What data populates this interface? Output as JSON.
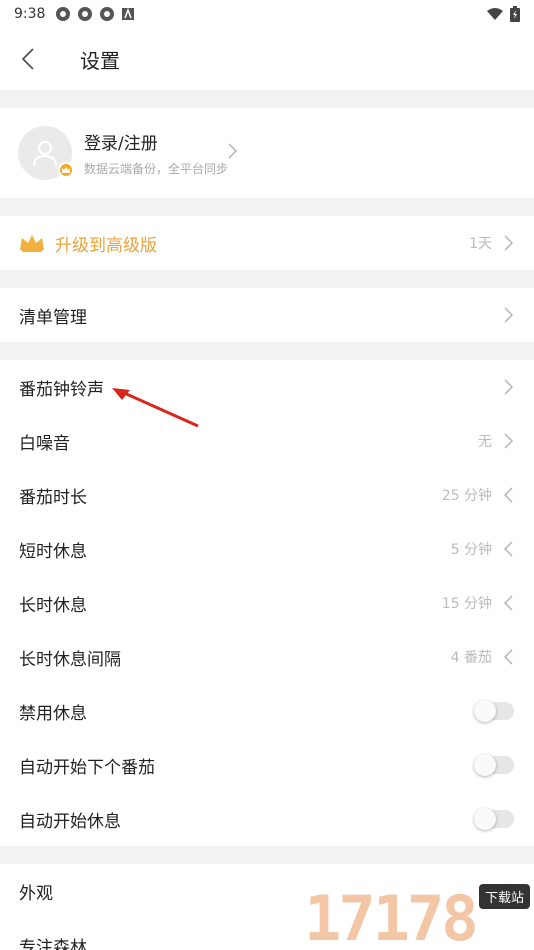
{
  "status_bar": {
    "time": "9:38"
  },
  "header": {
    "title": "设置"
  },
  "profile": {
    "title": "登录/注册",
    "subtitle": "数据云端备份，全平台同步"
  },
  "premium": {
    "label": "升级到高级版",
    "value": "1天"
  },
  "list_management": {
    "label": "清单管理"
  },
  "timer_settings": [
    {
      "label": "番茄钟铃声",
      "value": ""
    },
    {
      "label": "白噪音",
      "value": "无"
    },
    {
      "label": "番茄时长",
      "value": "25 分钟"
    },
    {
      "label": "短时休息",
      "value": "5 分钟"
    },
    {
      "label": "长时休息",
      "value": "15 分钟"
    },
    {
      "label": "长时休息间隔",
      "value": "4 番茄"
    }
  ],
  "toggles": [
    {
      "label": "禁用休息",
      "on": false
    },
    {
      "label": "自动开始下个番茄",
      "on": false
    },
    {
      "label": "自动开始休息",
      "on": false
    }
  ],
  "more": [
    {
      "label": "外观"
    },
    {
      "label": "专注森林"
    }
  ],
  "watermark": {
    "digits": "17178",
    "tag": "下载站"
  },
  "colors": {
    "accent": "#e8a33c",
    "arrow": "#d9261c"
  }
}
